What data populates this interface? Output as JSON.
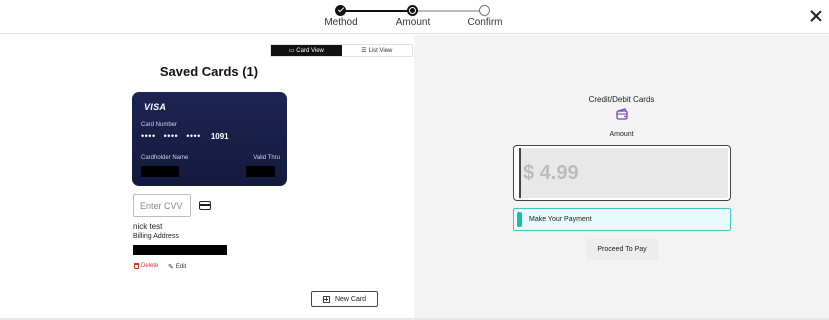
{
  "stepper": {
    "steps": [
      {
        "label": "Method",
        "state": "complete"
      },
      {
        "label": "Amount",
        "state": "current"
      },
      {
        "label": "Confirm",
        "state": "upcoming"
      }
    ]
  },
  "header": {
    "close_icon": "close-icon"
  },
  "view_toggle": {
    "card_view_label": "Card View",
    "list_view_label": "List View",
    "active": "Card View"
  },
  "saved_cards": {
    "title": "Saved Cards (1)",
    "card": {
      "brand": "VISA",
      "number_label": "Card Number",
      "masked_groups": [
        "••••",
        "••••",
        "••••"
      ],
      "last4": "1091",
      "holder_label": "Cardholder Name",
      "valid_label": "Valid Thru"
    },
    "cvv_placeholder": "Enter CVV",
    "holder_name": "nick test",
    "billing_label": "Billing Address",
    "delete_label": "Delete",
    "edit_label": "Edit",
    "new_card_label": "New Card"
  },
  "payment": {
    "method_title": "Credit/Debit Cards",
    "method_icon": "wallet-icon",
    "amount_label": "Amount",
    "amount_value": "$ 4.99",
    "make_payment_label": "Make Your Payment",
    "proceed_label": "Proceed To Pay"
  },
  "colors": {
    "card_bg": "#1d2452",
    "accent_teal": "#1bbab3",
    "delete_red": "#d33333",
    "wallet_purple": "#7a3db8"
  }
}
